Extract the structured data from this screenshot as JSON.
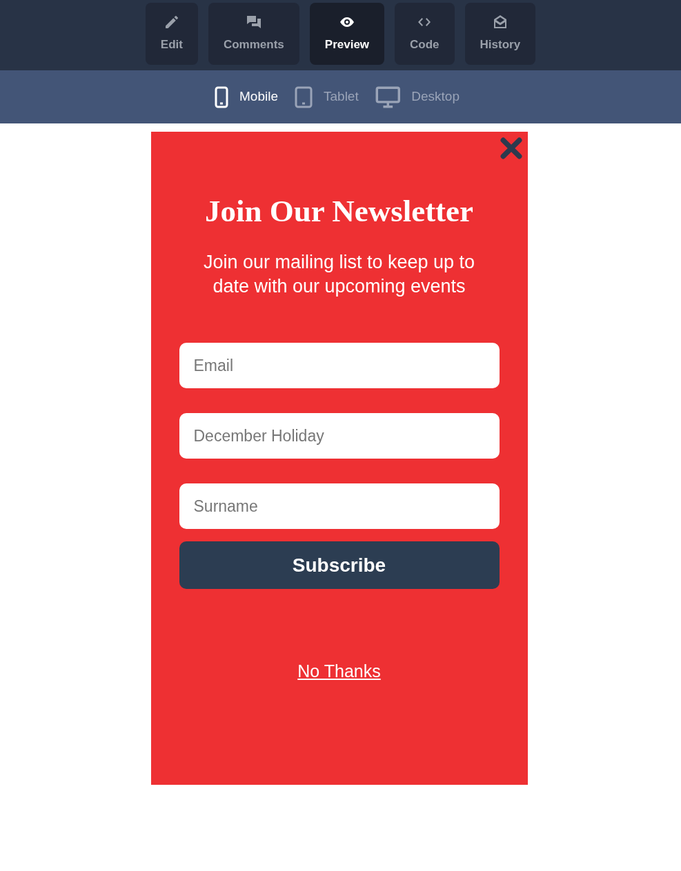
{
  "tabs": [
    {
      "kind": "edit",
      "label": "Edit",
      "selected": false
    },
    {
      "kind": "comments",
      "label": "Comments",
      "selected": false
    },
    {
      "kind": "preview",
      "label": "Preview",
      "selected": true
    },
    {
      "kind": "code",
      "label": "Code",
      "selected": false
    },
    {
      "kind": "history",
      "label": "History",
      "selected": false
    }
  ],
  "devices": [
    {
      "kind": "mobile",
      "label": "Mobile",
      "selected": true
    },
    {
      "kind": "tablet",
      "label": "Tablet",
      "selected": false
    },
    {
      "kind": "desktop",
      "label": "Desktop",
      "selected": false
    }
  ],
  "popup": {
    "title": "Join Our Newsletter",
    "subtitle": "Join our mailing list to keep up to date with our upcoming events",
    "fields": [
      {
        "placeholder": "Email"
      },
      {
        "placeholder": "December Holiday"
      },
      {
        "placeholder": "Surname"
      }
    ],
    "submit": "Subscribe",
    "dismiss": "No Thanks"
  }
}
